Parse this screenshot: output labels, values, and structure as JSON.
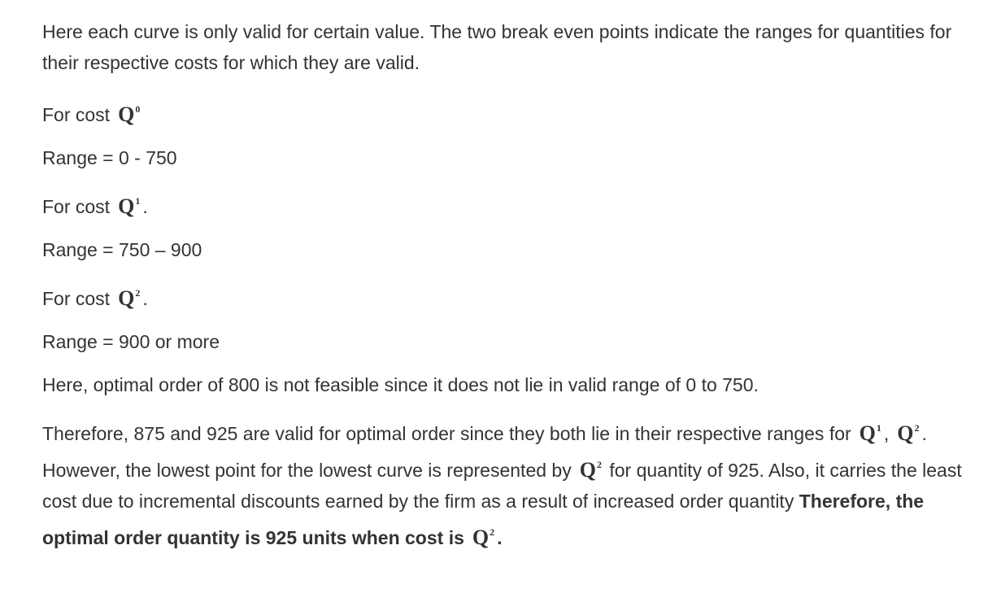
{
  "intro": "Here each curve is only valid for certain value. The two break even points indicate the ranges for quantities for their respective costs for which they are valid.",
  "q_symbol": "Q",
  "cost_label": "For cost",
  "items": [
    {
      "sup": "0",
      "suffix": "",
      "range": "Range = 0 - 750"
    },
    {
      "sup": "1",
      "suffix": ".",
      "range": "Range = 750 – 900"
    },
    {
      "sup": "2",
      "suffix": ".",
      "range": "Range = 900 or more"
    }
  ],
  "infeasible": "Here, optimal order of 800 is not feasible since it does not lie in valid range of 0 to 750.",
  "conclusion": {
    "part1": "Therefore, 875 and 925 are valid for optimal order since they both lie in their respective ranges for",
    "sup1": "1",
    "comma": ",",
    "sup2": "2",
    "part2": ". However, the lowest point for the lowest curve is represented by",
    "sup3": "2",
    "part3": "for quantity of 925. Also, it carries the least cost due to incremental discounts earned by the firm as a result of increased order quantity",
    "bold": "Therefore, the optimal order quantity is 925 units when cost is",
    "sup4": "2",
    "end": "."
  }
}
